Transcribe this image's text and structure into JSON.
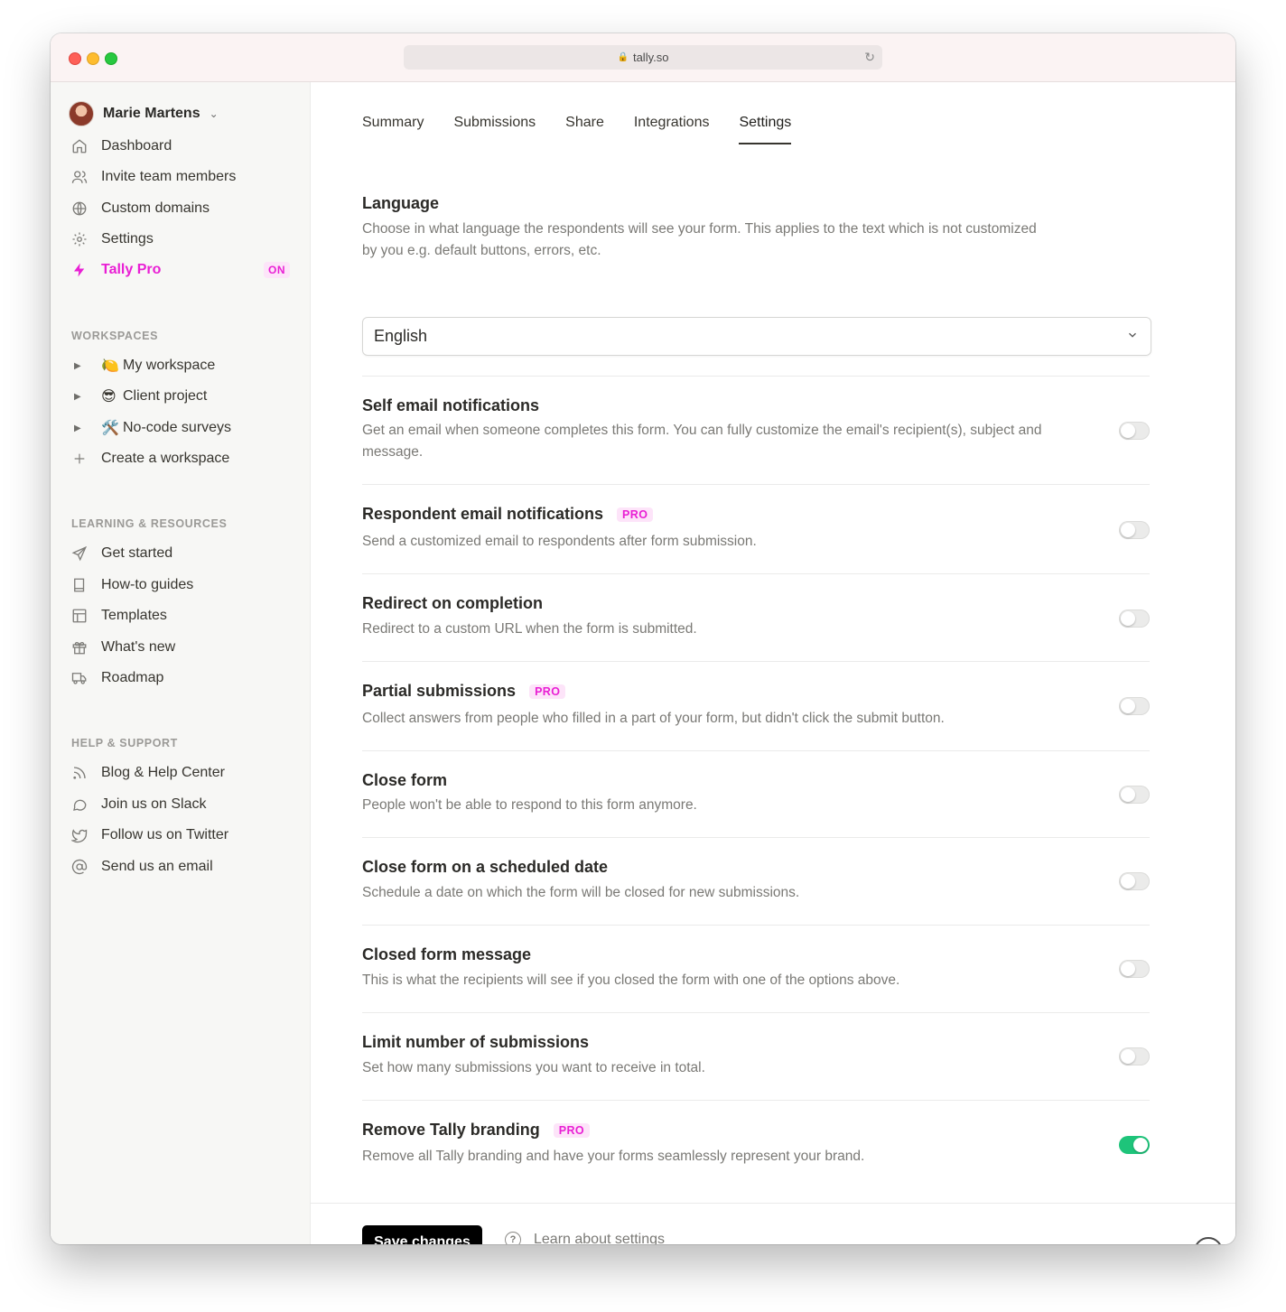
{
  "browser": {
    "url": "tally.so"
  },
  "sidebar": {
    "user": {
      "name": "Marie Martens"
    },
    "nav": [
      {
        "label": "Dashboard",
        "icon": "home-icon"
      },
      {
        "label": "Invite team members",
        "icon": "users-icon"
      },
      {
        "label": "Custom domains",
        "icon": "globe-icon"
      },
      {
        "label": "Settings",
        "icon": "gear-icon"
      },
      {
        "label": "Tally Pro",
        "icon": "lightning-icon",
        "badge": "ON"
      }
    ],
    "workspaces_label": "WORKSPACES",
    "workspaces": [
      {
        "emoji": "🍋",
        "label": "My workspace"
      },
      {
        "emoji": "😎",
        "label": "Client project"
      },
      {
        "emoji": "🛠️",
        "label": "No-code surveys"
      }
    ],
    "create_workspace": "Create a workspace",
    "learning_label": "LEARNING & RESOURCES",
    "learning": [
      {
        "label": "Get started",
        "icon": "send-icon"
      },
      {
        "label": "How-to guides",
        "icon": "book-icon"
      },
      {
        "label": "Templates",
        "icon": "layout-icon"
      },
      {
        "label": "What's new",
        "icon": "gift-icon"
      },
      {
        "label": "Roadmap",
        "icon": "truck-icon"
      }
    ],
    "help_label": "HELP & SUPPORT",
    "help": [
      {
        "label": "Blog & Help Center",
        "icon": "rss-icon"
      },
      {
        "label": "Join us on Slack",
        "icon": "chat-icon"
      },
      {
        "label": "Follow us on Twitter",
        "icon": "twitter-icon"
      },
      {
        "label": "Send us an email",
        "icon": "at-icon"
      }
    ]
  },
  "tabs": [
    {
      "label": "Summary"
    },
    {
      "label": "Submissions"
    },
    {
      "label": "Share"
    },
    {
      "label": "Integrations"
    },
    {
      "label": "Settings",
      "active": true
    }
  ],
  "language": {
    "title": "Language",
    "description": "Choose in what language the respondents will see your form. This applies to the text which is not customized by you e.g. default buttons, errors, etc.",
    "selected": "English"
  },
  "settings": [
    {
      "title": "Self email notifications",
      "description": "Get an email when someone completes this form. You can fully customize the email's recipient(s), subject and message.",
      "pro": false,
      "enabled": false
    },
    {
      "title": "Respondent email notifications",
      "description": "Send a customized email to respondents after form submission.",
      "pro": true,
      "enabled": false
    },
    {
      "title": "Redirect on completion",
      "description": "Redirect to a custom URL when the form is submitted.",
      "pro": false,
      "enabled": false
    },
    {
      "title": "Partial submissions",
      "description": "Collect answers from people who filled in a part of your form, but didn't click the submit button.",
      "pro": true,
      "enabled": false
    },
    {
      "title": "Close form",
      "description": "People won't be able to respond to this form anymore.",
      "pro": false,
      "enabled": false
    },
    {
      "title": "Close form on a scheduled date",
      "description": "Schedule a date on which the form will be closed for new submissions.",
      "pro": false,
      "enabled": false
    },
    {
      "title": "Closed form message",
      "description": "This is what the recipients will see if you closed the form with one of the options above.",
      "pro": false,
      "enabled": false
    },
    {
      "title": "Limit number of submissions",
      "description": "Set how many submissions you want to receive in total.",
      "pro": false,
      "enabled": false
    },
    {
      "title": "Remove Tally branding",
      "description": "Remove all Tally branding and have your forms seamlessly represent your brand.",
      "pro": true,
      "enabled": true
    }
  ],
  "pro_badge": "PRO",
  "footer": {
    "save_label": "Save changes",
    "learn_label": "Learn about settings",
    "help_glyph": "?"
  },
  "colors": {
    "accent": "#e91fd4",
    "toggle_on": "#1ec47a"
  }
}
